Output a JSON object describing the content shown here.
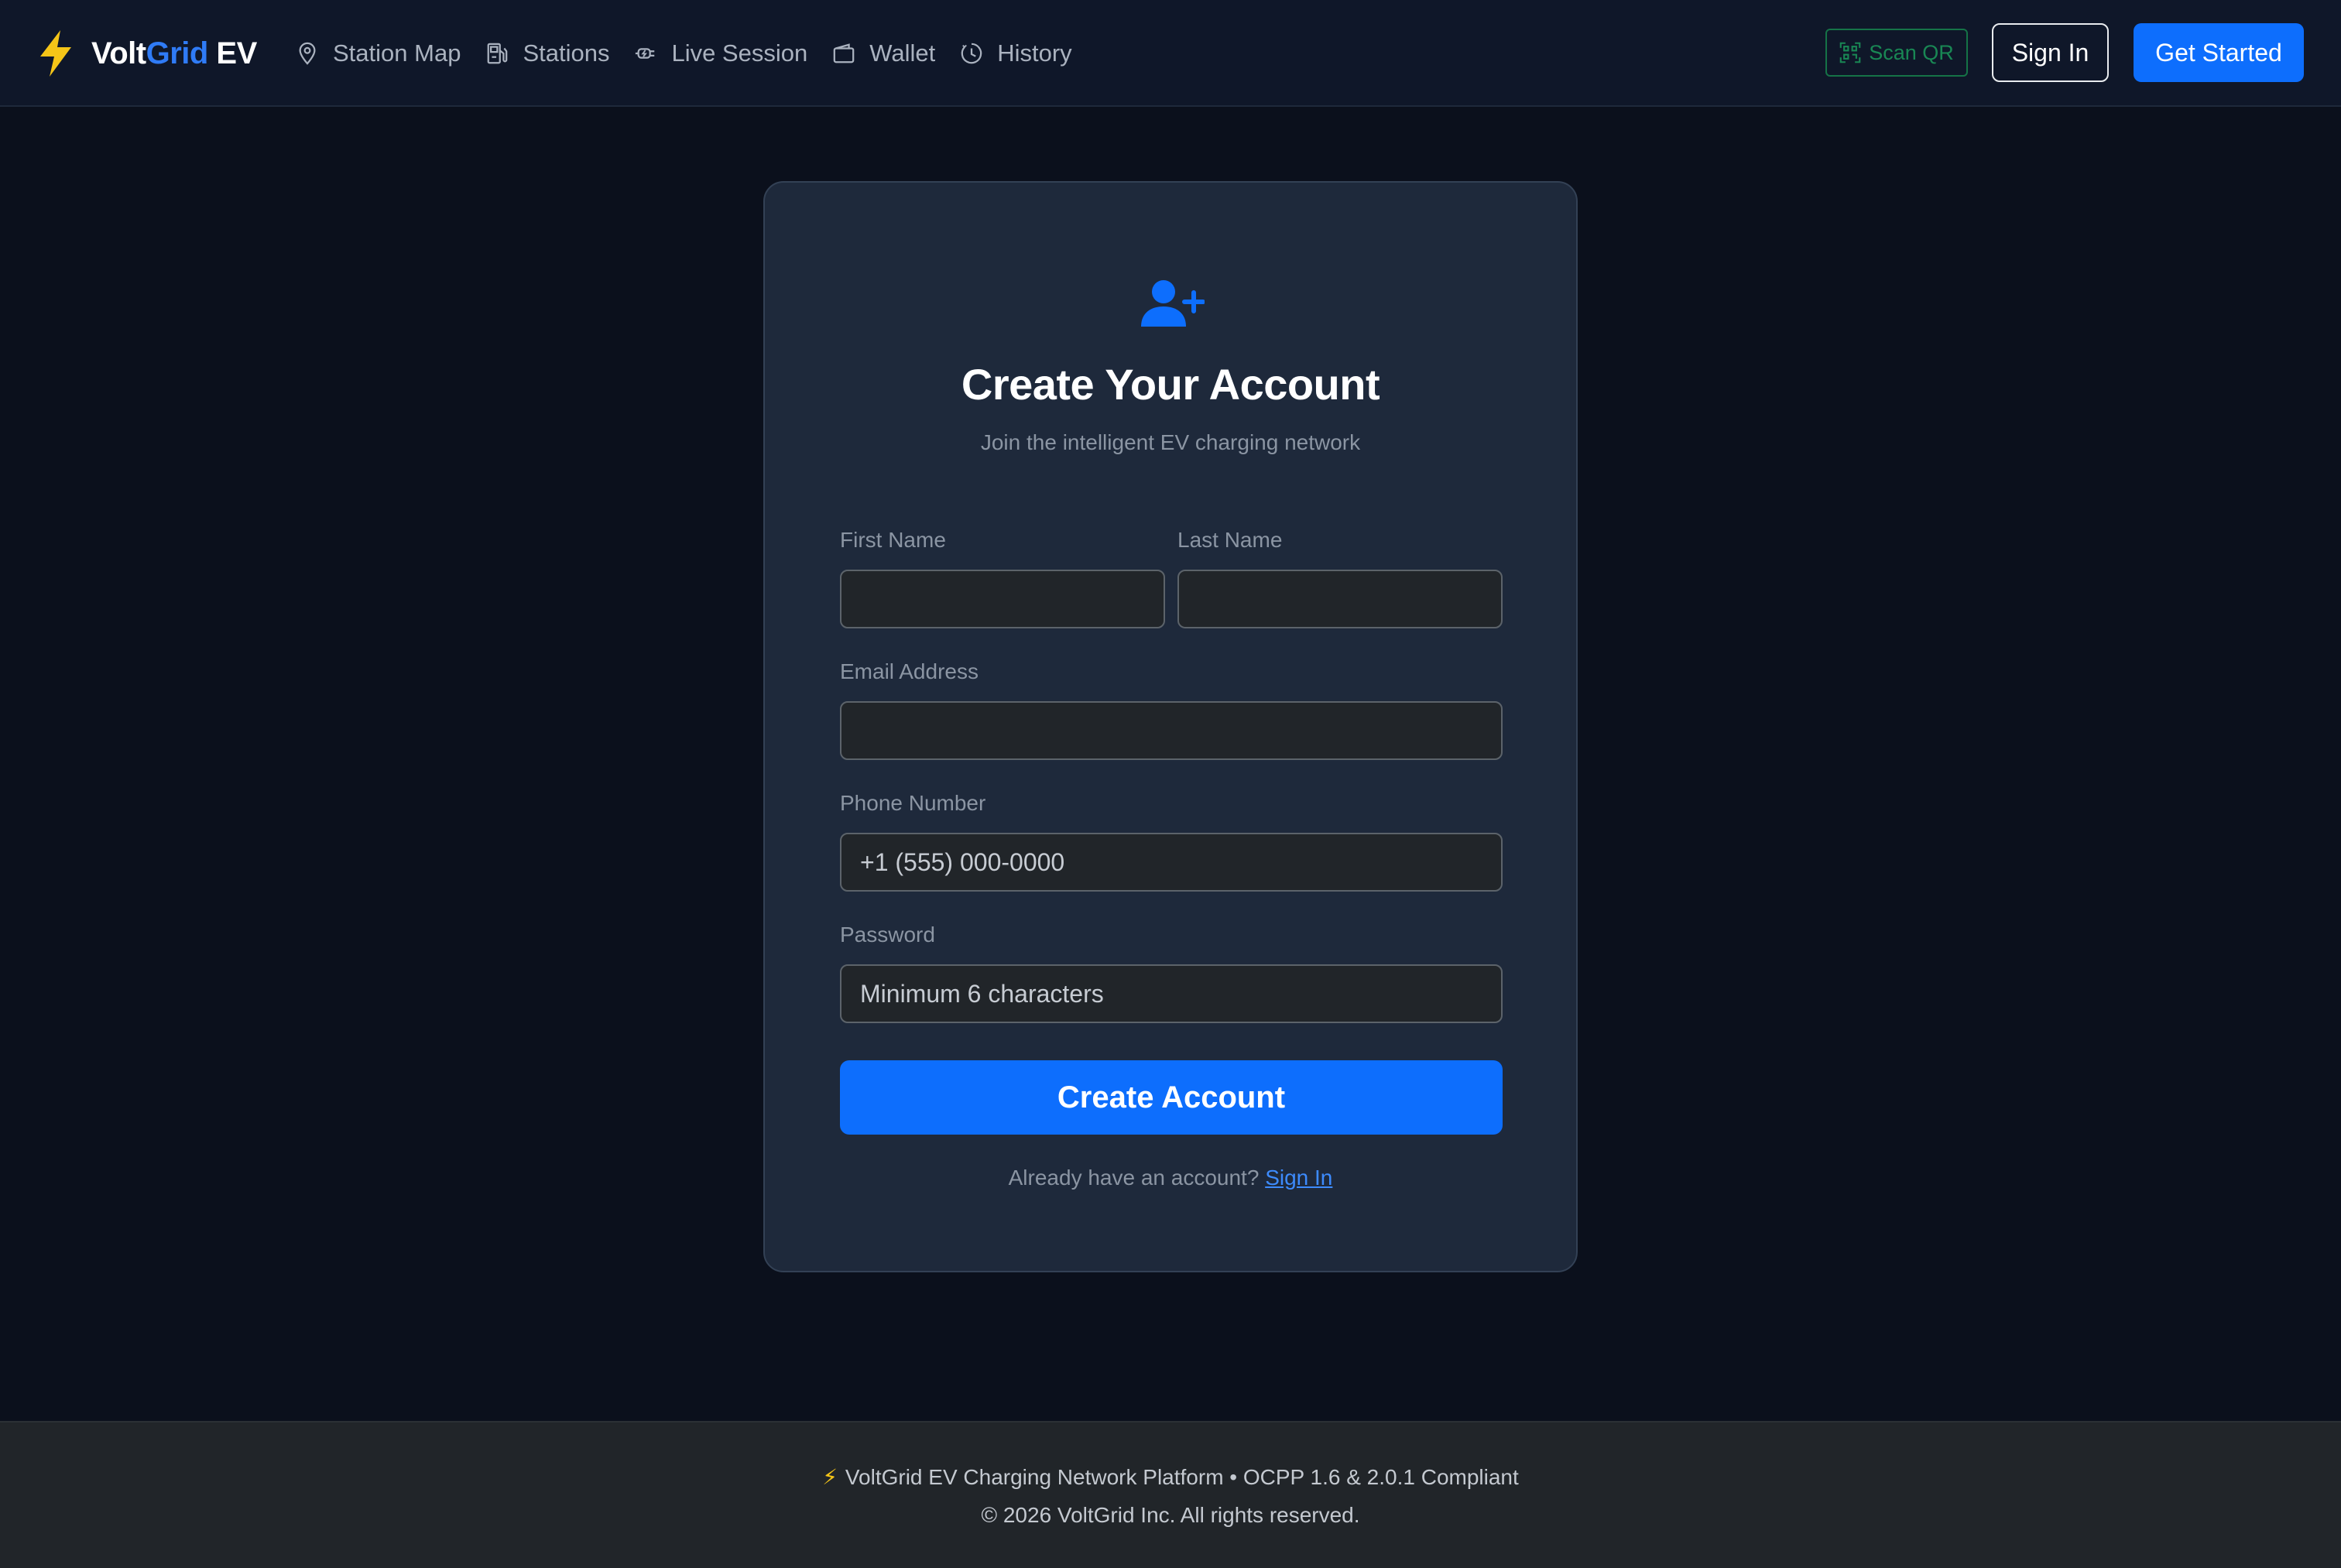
{
  "brand": {
    "name_volt": "Volt",
    "name_grid": "Grid",
    "name_ev": " EV"
  },
  "nav": {
    "items": [
      {
        "label": "Station Map",
        "icon": "map-pin-icon"
      },
      {
        "label": "Stations",
        "icon": "fuel-pump-icon"
      },
      {
        "label": "Live Session",
        "icon": "ev-plug-icon"
      },
      {
        "label": "Wallet",
        "icon": "wallet-icon"
      },
      {
        "label": "History",
        "icon": "clock-history-icon"
      }
    ],
    "scan_qr_label": "Scan QR",
    "sign_in_label": "Sign In",
    "get_started_label": "Get Started"
  },
  "form": {
    "icon": "person-plus-icon",
    "title": "Create Your Account",
    "subtitle": "Join the intelligent EV charging network",
    "first_name_label": "First Name",
    "first_name_value": "",
    "last_name_label": "Last Name",
    "last_name_value": "",
    "email_label": "Email Address",
    "email_value": "",
    "phone_label": "Phone Number",
    "phone_placeholder": "+1 (555) 000-0000",
    "password_label": "Password",
    "password_placeholder": "Minimum 6 characters",
    "submit_label": "Create Account",
    "signin_prompt": "Already have an account? ",
    "signin_link": "Sign In"
  },
  "footer": {
    "line1": "VoltGrid EV Charging Network Platform • OCPP 1.6 & 2.0.1 Compliant",
    "line2": "© 2026 VoltGrid Inc. All rights reserved."
  },
  "colors": {
    "accent": "#0d6efd",
    "brand_bolt": "#f5c518",
    "success_outline": "#198754",
    "page_bg": "#0b101c",
    "card_bg": "#1e293b"
  }
}
